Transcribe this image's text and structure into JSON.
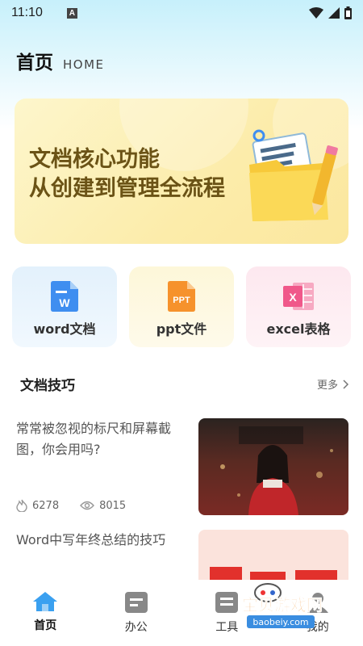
{
  "status_bar": {
    "time": "11:10",
    "indicator": "A",
    "icons": [
      "wifi-icon",
      "signal-icon",
      "battery-icon"
    ]
  },
  "header": {
    "title": "首页",
    "subtitle": "HOME"
  },
  "banner": {
    "line1": "文档核心功能",
    "line2": "从创建到管理全流程",
    "icon": "folder-icon"
  },
  "features": [
    {
      "label": "word文档",
      "icon": "word-file-icon",
      "icon_text": "W",
      "color": "#3f8ef0"
    },
    {
      "label": "ppt文件",
      "icon": "ppt-file-icon",
      "icon_text": "PPT",
      "color": "#f6922c"
    },
    {
      "label": "excel表格",
      "icon": "excel-file-icon",
      "icon_text": "X",
      "color": "#f0588a"
    }
  ],
  "tips": {
    "title": "文档技巧",
    "more": "更多",
    "articles": [
      {
        "title": "常常被忽视的标尺和屏幕截图，你会用吗?",
        "likes": "6278",
        "views": "8015"
      },
      {
        "title": "Word中写年终总结的技巧"
      }
    ]
  },
  "bottom_nav": [
    {
      "label": "首页",
      "icon": "home-icon",
      "active": true
    },
    {
      "label": "办公",
      "icon": "office-icon",
      "active": false
    },
    {
      "label": "工具",
      "icon": "tools-icon",
      "active": false
    },
    {
      "label": "我的",
      "icon": "profile-icon",
      "active": false
    }
  ],
  "watermark": {
    "text": "宝贝游戏网",
    "url": "baobeiy.com"
  },
  "colors": {
    "banner_text": "#6b5316",
    "word_blue": "#3f8ef0",
    "ppt_orange": "#f6922c",
    "excel_pink": "#f0588a",
    "nav_active": "#3aa0f0"
  }
}
